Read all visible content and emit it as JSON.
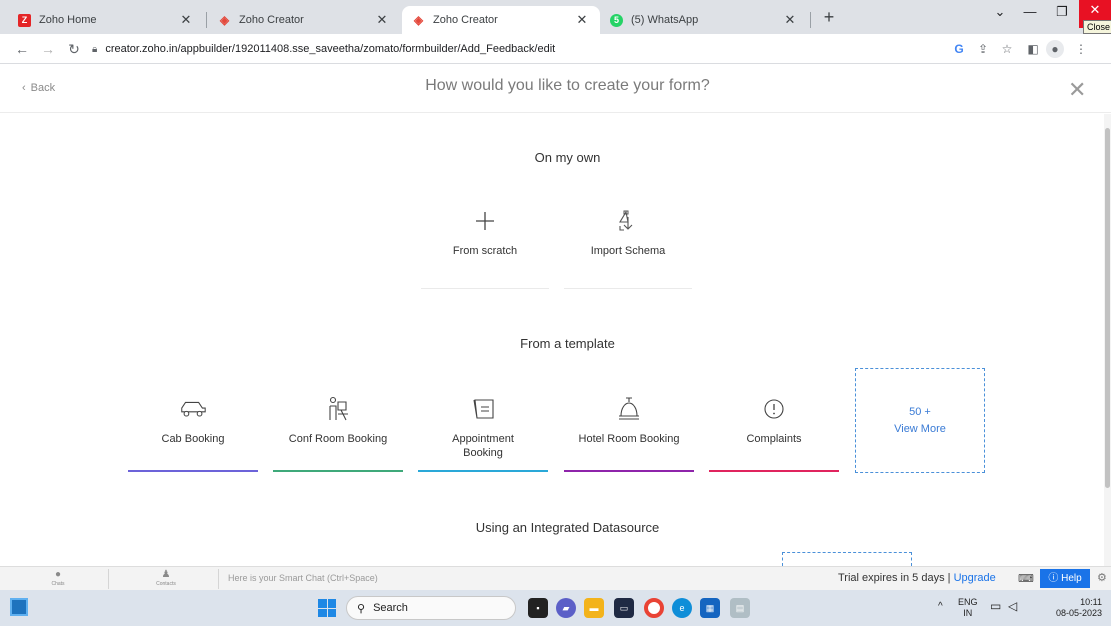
{
  "browser": {
    "tabs": [
      {
        "title": "Zoho Home",
        "favicon": "Z",
        "color": "#e42527",
        "active": false
      },
      {
        "title": "Zoho Creator",
        "favicon": "◈",
        "color": "#e4483b",
        "active": false
      },
      {
        "title": "Zoho Creator",
        "favicon": "◈",
        "color": "#e4483b",
        "active": true
      },
      {
        "title": "(5) WhatsApp",
        "favicon": "5",
        "color": "#25d366",
        "active": false
      }
    ],
    "close_tooltip": "Close",
    "url": "creator.zoho.in/appbuilder/192011408.sse_saveetha/zomato/formbuilder/Add_Feedback/edit"
  },
  "header": {
    "back_label": "Back",
    "title": "How would you like to create your form?"
  },
  "own": {
    "title": "On my own",
    "options": [
      {
        "label": "From scratch"
      },
      {
        "label": "Import Schema"
      }
    ]
  },
  "template": {
    "title": "From a template",
    "cards": [
      {
        "label": "Cab Booking",
        "accent": "#6c63d9"
      },
      {
        "label": "Conf Room Booking",
        "accent": "#3fa97a"
      },
      {
        "label": "Appointment Booking",
        "accent": "#2aa8d8"
      },
      {
        "label": "Hotel Room Booking",
        "accent": "#8e24aa"
      },
      {
        "label": "Complaints",
        "accent": "#e0245e"
      }
    ],
    "view_more_count": "50 +",
    "view_more_label": "View More"
  },
  "datasource": {
    "title": "Using an Integrated Datasource"
  },
  "zoho_bar": {
    "chats": "Chats",
    "contacts": "Contacts",
    "smart_chat_placeholder": "Here is your Smart Chat (Ctrl+Space)",
    "trial_text": "Trial expires in 5 days",
    "upgrade": "Upgrade",
    "help": "Help"
  },
  "taskbar": {
    "search": "Search",
    "lang_top": "ENG",
    "lang_bottom": "IN",
    "time": "10:11",
    "date": "08-05-2023"
  }
}
